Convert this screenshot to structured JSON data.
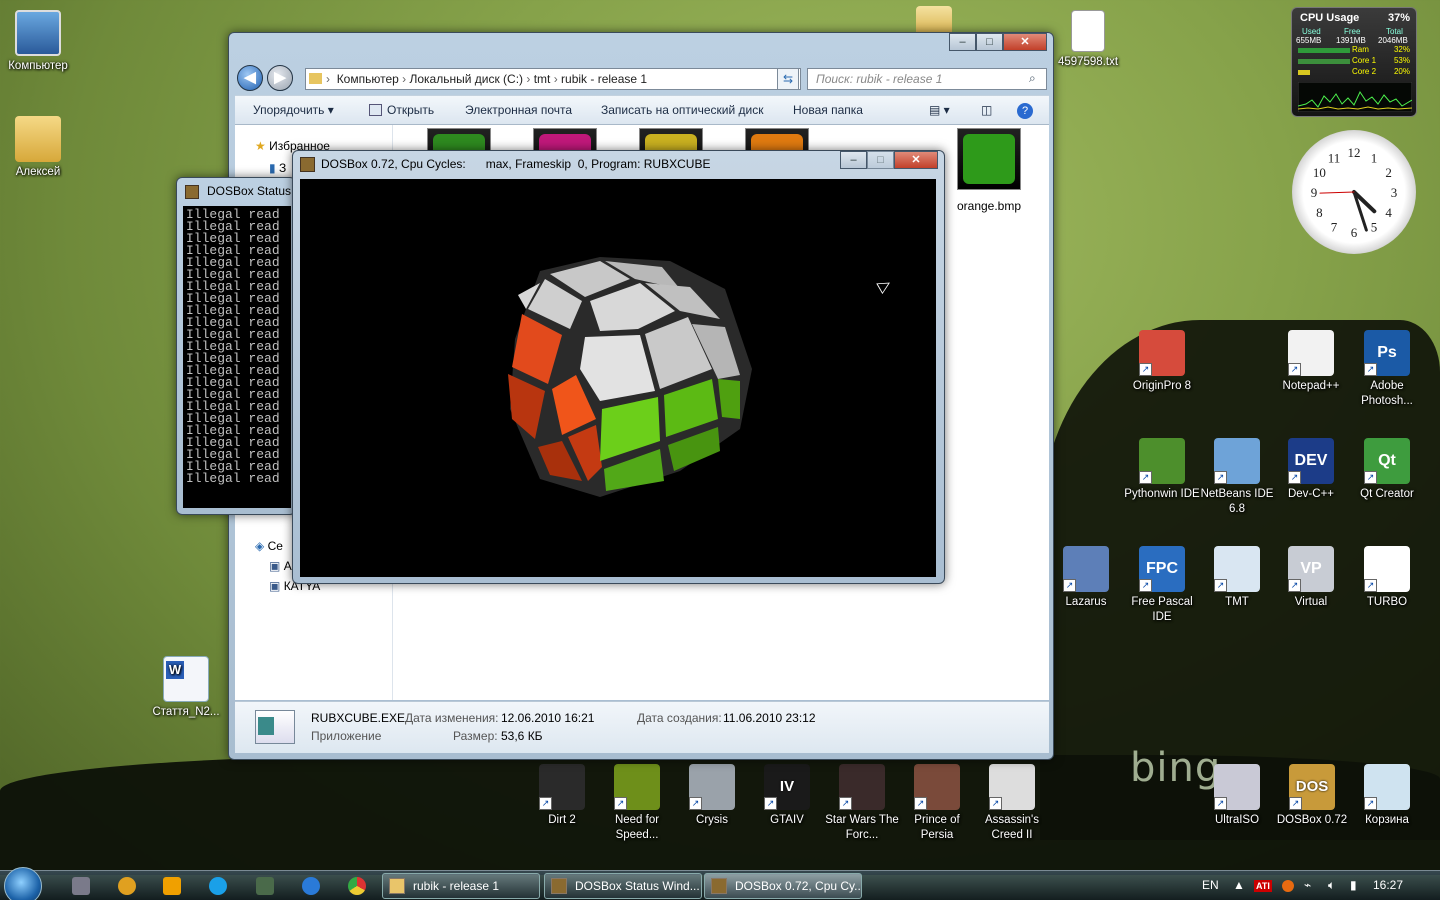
{
  "desktop": {
    "left_icons": [
      {
        "label": "Компьютер"
      },
      {
        "label": "Алексей"
      },
      {
        "label": "Стаття_N2..."
      }
    ],
    "top_icons": [
      {
        "label": "4597598.txt"
      }
    ],
    "right_icons": [
      {
        "label": "OriginPro 8",
        "color": "#d64b3c"
      },
      {
        "label": "Notepad++",
        "color": "#f2f2f2"
      },
      {
        "label": "Adobe Photosh...",
        "color": "#1b5aa6",
        "glyph": "Ps"
      },
      {
        "label": "Pythonwin IDE",
        "color": "#4d8f2c"
      },
      {
        "label": "NetBeans IDE 6.8",
        "color": "#6ea3d8"
      },
      {
        "label": "Dev-C++",
        "color": "#1c3c88",
        "glyph": "DEV"
      },
      {
        "label": "Qt Creator",
        "color": "#3e9c3e",
        "glyph": "Qt"
      },
      {
        "label": "Lazarus",
        "color": "#5d7fb8"
      },
      {
        "label": "Free Pascal IDE",
        "color": "#2a6dc0",
        "glyph": "FPC"
      },
      {
        "label": "TMT",
        "color": "#d9e6f2"
      },
      {
        "label": "Virtual",
        "color": "#c8ccd4",
        "glyph": "VP"
      },
      {
        "label": "TURBO",
        "color": "#ffffff"
      }
    ],
    "bottom_icons": [
      {
        "label": "Dirt 2",
        "color": "#2a2a2a"
      },
      {
        "label": "Need for Speed...",
        "color": "#6e8f1a"
      },
      {
        "label": "Crysis",
        "color": "#9aa2aa"
      },
      {
        "label": "GTAIV",
        "color": "#1a1a1a",
        "glyph": "IV"
      },
      {
        "label": "Star Wars The Forc...",
        "color": "#3a2a2a"
      },
      {
        "label": "Prince of Persia",
        "color": "#7a4a3a"
      },
      {
        "label": "Assassin's Creed II",
        "color": "#dddddd"
      },
      {
        "label": "UltraISO",
        "color": "#c9c9d6"
      },
      {
        "label": "DOSBox 0.72",
        "color": "#c89a3a",
        "glyph": "DOS"
      },
      {
        "label": "Корзина",
        "color": "#cfe3f0"
      }
    ],
    "watermark": "bing"
  },
  "explorer": {
    "breadcrumb": [
      "Компьютер",
      "Локальный диск (C:)",
      "tmt",
      "rubik - release 1"
    ],
    "search_placeholder": "Поиск: rubik - release 1",
    "toolbar": {
      "organize": "Упорядочить",
      "open": "Открыть",
      "email": "Электронная почта",
      "burn": "Записать на оптический диск",
      "new_folder": "Новая папка"
    },
    "nav": {
      "favorites": "Избранное",
      "favorites_sub": "З",
      "network": "Се",
      "net_1": "А",
      "net_2": "КАТYA"
    },
    "thumbs": [
      {
        "color": "#2e8a1f"
      },
      {
        "color": "#c0187a"
      },
      {
        "color": "#c9b020"
      },
      {
        "color": "#e07a10"
      },
      {
        "color": "#2e9a1a",
        "label": "orange.bmp"
      }
    ],
    "details": {
      "filename": "RUBXCUBE.EXE",
      "type": "Приложение",
      "modified_label": "Дата изменения:",
      "modified": "12.06.2010 16:21",
      "size_label": "Размер:",
      "size": "53,6 КБ",
      "created_label": "Дата создания:",
      "created": "11.06.2010 23:12"
    }
  },
  "status_window": {
    "title": "DOSBox Status",
    "lines": [
      "Illegal read",
      "Illegal read",
      "Illegal read",
      "Illegal read",
      "Illegal read",
      "Illegal read",
      "Illegal read",
      "Illegal read",
      "Illegal read",
      "Illegal read",
      "Illegal read",
      "Illegal read",
      "Illegal read",
      "Illegal read",
      "Illegal read",
      "Illegal read",
      "Illegal read",
      "Illegal read",
      "Illegal read",
      "Illegal read",
      "Illegal read",
      "Illegal read",
      "Illegal read"
    ]
  },
  "dosbox_window": {
    "title": "DOSBox 0.72, Cpu Cycles:      max, Frameskip  0, Program: RUBXCUBE"
  },
  "cpu_gadget": {
    "title": "CPU Usage",
    "percent": "37%",
    "used_label": "Used",
    "free_label": "Free",
    "total_label": "Total",
    "used": "655MB",
    "free": "1391MB",
    "total": "2046MB",
    "ram_label": "Ram",
    "ram": "32%",
    "core1_label": "Core 1",
    "core1": "53%",
    "core2_label": "Core 2",
    "core2": "20%"
  },
  "clock": {
    "hour": 4,
    "minute": 27,
    "numerals": [
      "12",
      "1",
      "2",
      "3",
      "4",
      "5",
      "6",
      "7",
      "8",
      "9",
      "10",
      "11"
    ]
  },
  "taskbar": {
    "tasks": [
      {
        "label": "rubik - release 1"
      },
      {
        "label": "DOSBox Status Wind..."
      },
      {
        "label": "DOSBox 0.72, Cpu Cy..."
      }
    ],
    "lang": "EN",
    "time": "16:27"
  }
}
